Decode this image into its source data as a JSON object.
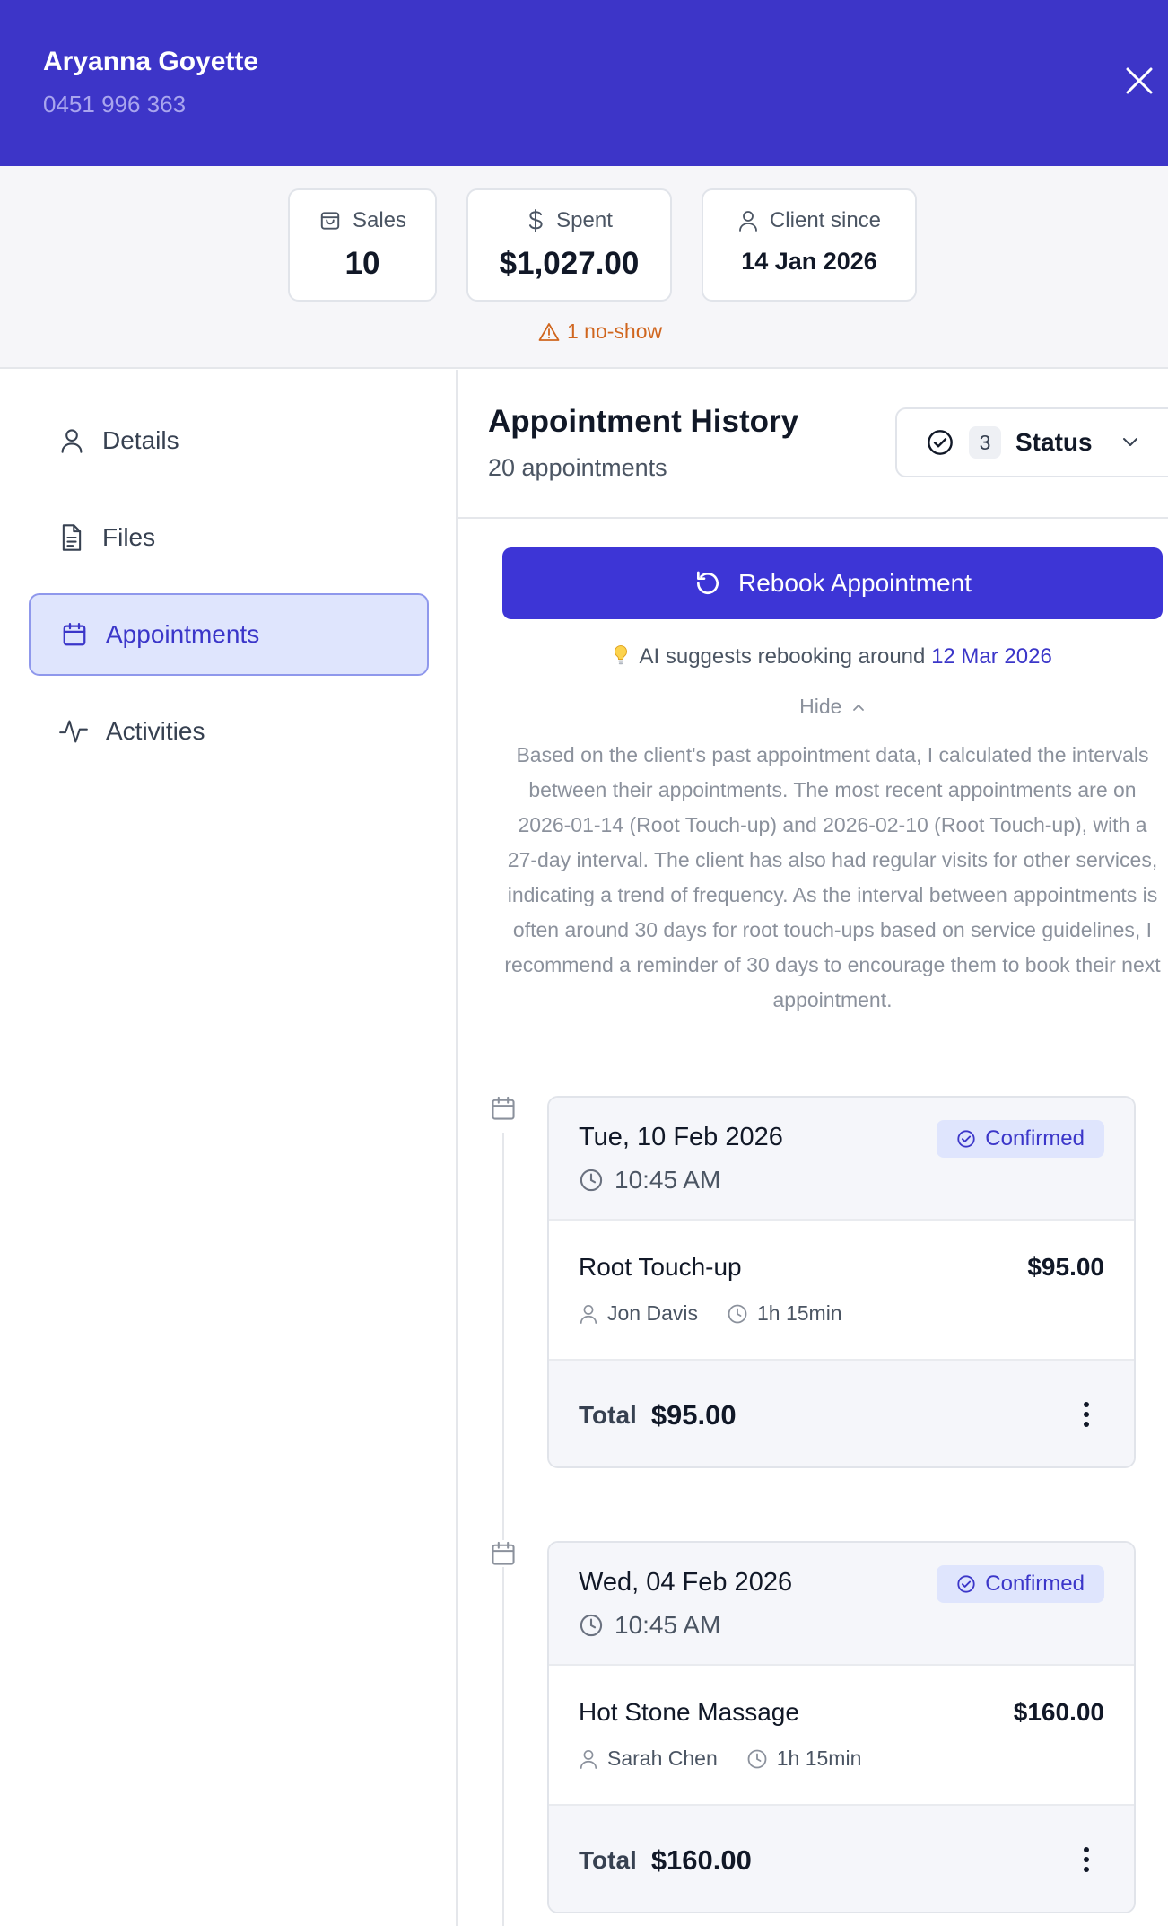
{
  "header": {
    "client_name": "Aryanna Goyette",
    "phone": "0451 996 363"
  },
  "stats": {
    "sales_label": "Sales",
    "sales_value": "10",
    "spent_label": "Spent",
    "spent_value": "$1,027.00",
    "client_since_label": "Client since",
    "client_since_value": "14 Jan 2026",
    "noshow": "1 no-show"
  },
  "sidebar": {
    "items": [
      {
        "label": "Details",
        "icon": "user-icon"
      },
      {
        "label": "Files",
        "icon": "file-icon"
      },
      {
        "label": "Appointments",
        "icon": "calendar-icon",
        "active": true
      },
      {
        "label": "Activities",
        "icon": "activity-icon"
      }
    ]
  },
  "main": {
    "title": "Appointment History",
    "subtitle": "20 appointments",
    "status_filter": {
      "count": "3",
      "label": "Status"
    },
    "rebook_label": "Rebook Appointment",
    "ai_suggest_prefix": "AI suggests rebooking around",
    "ai_suggest_date": "12 Mar 2026",
    "hide_label": "Hide",
    "reasoning": "Based on the client's past appointment data, I calculated the intervals between their appointments. The most recent appointments are on 2026-01-14 (Root Touch-up) and 2026-02-10 (Root Touch-up), with a 27-day interval. The client has also had regular visits for other services, indicating a trend of frequency. As the interval between appointments is often around 30 days for root touch-ups based on service guidelines, I recommend a reminder of 30 days to encourage them to book their next appointment."
  },
  "appointments": [
    {
      "date": "Tue, 10 Feb 2026",
      "time": "10:45 AM",
      "status": "Confirmed",
      "service": "Root Touch-up",
      "price": "$95.00",
      "staff": "Jon Davis",
      "duration": "1h 15min",
      "total_label": "Total",
      "total": "$95.00"
    },
    {
      "date": "Wed, 04 Feb 2026",
      "time": "10:45 AM",
      "status": "Confirmed",
      "service": "Hot Stone Massage",
      "price": "$160.00",
      "staff": "Sarah Chen",
      "duration": "1h 15min",
      "total_label": "Total",
      "total": "$160.00"
    }
  ],
  "colors": {
    "header_bg": "#3d35c8",
    "accent": "#3d35d6",
    "active_bg": "#dfe5fd",
    "noshow": "#d0661f"
  }
}
